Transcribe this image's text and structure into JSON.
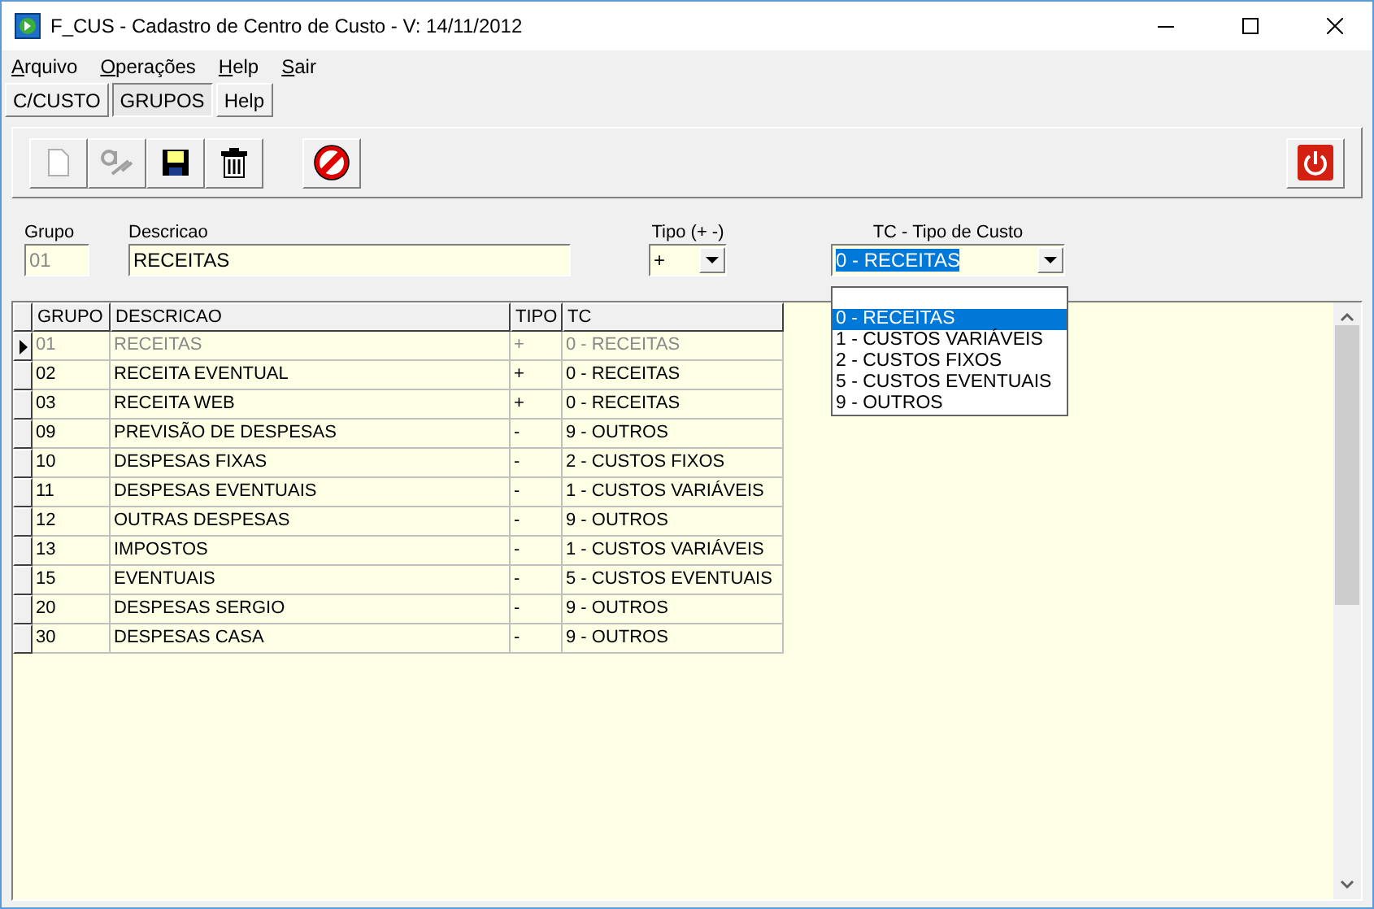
{
  "window": {
    "title": "F_CUS - Cadastro de Centro de Custo - V: 14/11/2012"
  },
  "menu": [
    {
      "label": "Arquivo"
    },
    {
      "label": "Operações"
    },
    {
      "label": "Help"
    },
    {
      "label": "Sair"
    }
  ],
  "tabs": [
    {
      "label": "C/CUSTO",
      "selected": false
    },
    {
      "label": "GRUPOS",
      "selected": true
    },
    {
      "label": "Help",
      "selected": false
    }
  ],
  "toolbar": [
    {
      "kind": "new",
      "disabled": true
    },
    {
      "kind": "edit",
      "disabled": true
    },
    {
      "kind": "save",
      "disabled": false
    },
    {
      "kind": "delete",
      "disabled": false
    },
    {
      "kind": "cancel",
      "disabled": false
    }
  ],
  "form": {
    "grupo": {
      "label": "Grupo",
      "value": "01",
      "disabled": true
    },
    "descricao": {
      "label": "Descricao",
      "value": "RECEITAS"
    },
    "tipo": {
      "label": "Tipo (+ -)",
      "value": "+"
    },
    "tc": {
      "label": "TC - Tipo de Custo",
      "value": "0 - RECEITAS",
      "expanded": true,
      "options": [
        {
          "label": "0 - RECEITAS",
          "selected": true
        },
        {
          "label": "1 - CUSTOS VARIÁVEIS",
          "selected": false
        },
        {
          "label": "2 - CUSTOS FIXOS",
          "selected": false
        },
        {
          "label": "5 - CUSTOS EVENTUAIS",
          "selected": false
        },
        {
          "label": "9 - OUTROS",
          "selected": false
        }
      ]
    }
  },
  "table": {
    "columns": [
      "GRUPO",
      "DESCRICAO",
      "TIPO",
      "TC"
    ],
    "rows": [
      {
        "cells": [
          "01",
          "RECEITAS",
          "+",
          "0 - RECEITAS"
        ],
        "selected": true
      },
      {
        "cells": [
          "02",
          "RECEITA EVENTUAL",
          "+",
          "0 - RECEITAS"
        ],
        "selected": false
      },
      {
        "cells": [
          "03",
          "RECEITA WEB",
          "+",
          "0 - RECEITAS"
        ],
        "selected": false
      },
      {
        "cells": [
          "09",
          "PREVISÃO DE DESPESAS",
          "-",
          "9 - OUTROS"
        ],
        "selected": false
      },
      {
        "cells": [
          "10",
          "DESPESAS FIXAS",
          "-",
          "2 - CUSTOS FIXOS"
        ],
        "selected": false
      },
      {
        "cells": [
          "11",
          "DESPESAS EVENTUAIS",
          "-",
          "1 - CUSTOS VARIÁVEIS"
        ],
        "selected": false
      },
      {
        "cells": [
          "12",
          "OUTRAS DESPESAS",
          "-",
          "9 - OUTROS"
        ],
        "selected": false
      },
      {
        "cells": [
          "13",
          "IMPOSTOS",
          "-",
          "1 - CUSTOS VARIÁVEIS"
        ],
        "selected": false
      },
      {
        "cells": [
          "15",
          "EVENTUAIS",
          "-",
          "5 - CUSTOS EVENTUAIS"
        ],
        "selected": false
      },
      {
        "cells": [
          "20",
          "DESPESAS SERGIO",
          "-",
          "9 - OUTROS"
        ],
        "selected": false
      },
      {
        "cells": [
          "30",
          "DESPESAS CASA",
          "-",
          "9 - OUTROS"
        ],
        "selected": false
      }
    ]
  }
}
